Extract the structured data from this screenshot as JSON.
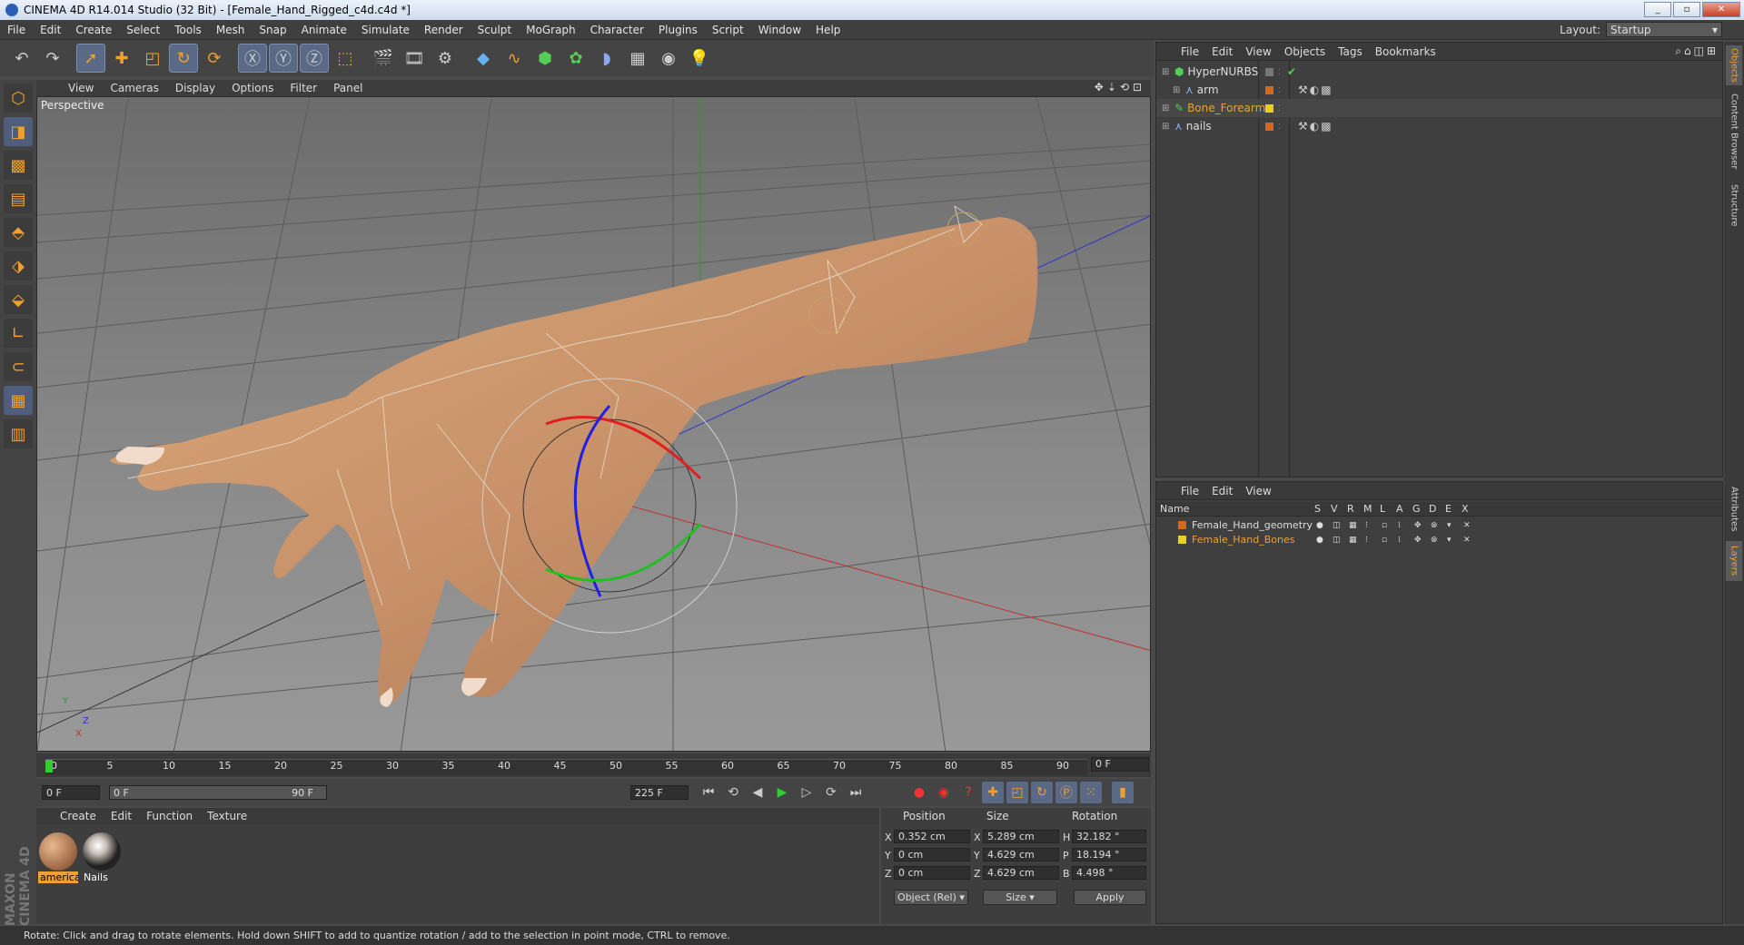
{
  "window": {
    "title": "CINEMA 4D R14.014 Studio (32 Bit) - [Female_Hand_Rigged_c4d.c4d *]",
    "min": "_",
    "max": "▫",
    "close": "✕"
  },
  "menubar": {
    "items": [
      "File",
      "Edit",
      "Create",
      "Select",
      "Tools",
      "Mesh",
      "Snap",
      "Animate",
      "Simulate",
      "Render",
      "Sculpt",
      "MoGraph",
      "Character",
      "Plugins",
      "Script",
      "Window",
      "Help"
    ]
  },
  "layout": {
    "label": "Layout:",
    "value": "Startup"
  },
  "viewport": {
    "menu": [
      "View",
      "Cameras",
      "Display",
      "Options",
      "Filter",
      "Panel"
    ],
    "label": "Perspective",
    "axis_labels": {
      "y": "Y",
      "z": "Z",
      "x": "X"
    }
  },
  "timeline": {
    "ticks": [
      "0",
      "5",
      "10",
      "15",
      "20",
      "25",
      "30",
      "35",
      "40",
      "45",
      "50",
      "55",
      "60",
      "65",
      "70",
      "75",
      "80",
      "85",
      "90"
    ],
    "current_frame": "0 F"
  },
  "transport": {
    "start": "0 F",
    "range_start": "0 F",
    "range_end": "90 F",
    "end": "225 F"
  },
  "materials": {
    "menu": [
      "Create",
      "Edit",
      "Function",
      "Texture"
    ],
    "items": [
      {
        "label": "americal"
      },
      {
        "label": "Nails"
      }
    ]
  },
  "coords": {
    "headers": [
      "Position",
      "Size",
      "Rotation"
    ],
    "rows": [
      {
        "axis": "X",
        "pos": "0.352 cm",
        "saxis": "X",
        "size": "5.289 cm",
        "raxis": "H",
        "rot": "32.182 °"
      },
      {
        "axis": "Y",
        "pos": "0 cm",
        "saxis": "Y",
        "size": "4.629 cm",
        "raxis": "P",
        "rot": "18.194 °"
      },
      {
        "axis": "Z",
        "pos": "0 cm",
        "saxis": "Z",
        "size": "4.629 cm",
        "raxis": "B",
        "rot": "4.498 °"
      }
    ],
    "mode": "Object (Rel)",
    "size_mode": "Size",
    "apply": "Apply"
  },
  "objects": {
    "menu": [
      "File",
      "Edit",
      "View",
      "Objects",
      "Tags",
      "Bookmarks"
    ],
    "items": [
      {
        "name": "HyperNURBS",
        "color": "#dddddd"
      },
      {
        "name": "arm",
        "color": "#dddddd"
      },
      {
        "name": "Bone_Forearm",
        "color": "#f0a030"
      },
      {
        "name": "nails",
        "color": "#dddddd"
      }
    ]
  },
  "layers": {
    "menu": [
      "File",
      "Edit",
      "View"
    ],
    "columns": [
      "Name",
      "S",
      "V",
      "R",
      "M",
      "L",
      "A",
      "G",
      "D",
      "E",
      "X"
    ],
    "items": [
      {
        "name": "Female_Hand_geometry",
        "color": "#d2691e",
        "text_color": "#dddddd"
      },
      {
        "name": "Female_Hand_Bones",
        "color": "#e8d020",
        "text_color": "#f0a030"
      }
    ]
  },
  "sidetabs": {
    "top": [
      "Objects",
      "Content Browser",
      "Structure"
    ],
    "bottom": [
      "Attributes",
      "Layers"
    ]
  },
  "status": "Rotate: Click and drag to rotate elements. Hold down SHIFT to add to quantize rotation / add to the selection in point mode, CTRL to remove.",
  "brand": "MAXON CINEMA 4D"
}
